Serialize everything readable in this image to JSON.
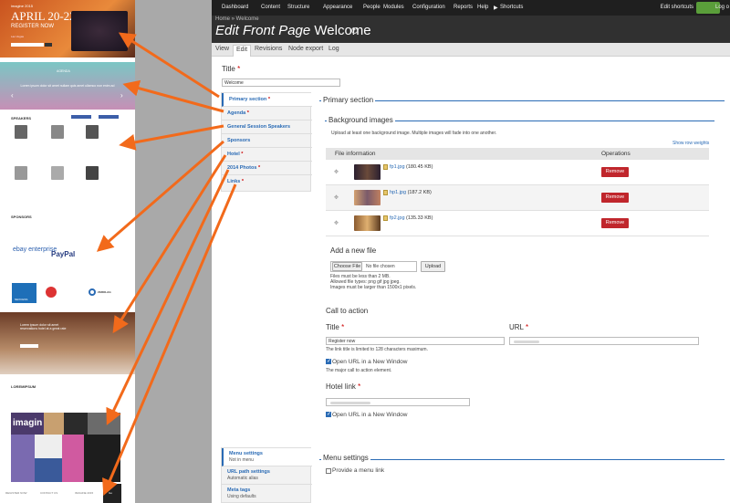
{
  "preview": {
    "hero": {
      "brand": "imagine 2015",
      "date": "APRIL 20-22",
      "register": "REGISTER NOW",
      "subtitle": "Las Vegas"
    },
    "agenda": {
      "title": "AGENDA",
      "text": "Lorem ipsum dolor sit amet nullam quis amet ullamco non enim ad"
    },
    "speakers_heading": "SPEAKERS",
    "sponsors_heading": "SPONSORS",
    "sponsor_logos": [
      "ebay enterprise",
      "PayPal",
      "NEXCESS",
      "ZEROLAG"
    ],
    "hotel_text": "Lorem ipsum dolor sit amet reservations hotel at a great rate",
    "lorem_heading": "LOREMIPSUM",
    "photo_word": "imagin",
    "footer": [
      "REGISTER NOW",
      "CONTACT US",
      "IMAGINE 2015",
      "Go"
    ]
  },
  "toolbar": {
    "items": [
      "Dashboard",
      "Content",
      "Structure",
      "Appearance",
      "People",
      "Modules",
      "Configuration",
      "Reports",
      "Help"
    ],
    "shortcuts": "Shortcuts",
    "edit_shortcuts": "Edit shortcuts",
    "logout": "Log o"
  },
  "header": {
    "breadcrumb": "Home » Welcome",
    "title_prefix": "Edit Front Page",
    "title_name": "Welcome"
  },
  "tabs": [
    "View",
    "Edit",
    "Revisions",
    "Node export",
    "Log"
  ],
  "title_field": {
    "label": "Title",
    "value": "Welcome"
  },
  "vertical_tabs": [
    {
      "label": "Primary section",
      "required": true
    },
    {
      "label": "Agenda",
      "required": true
    },
    {
      "label": "General Session Speakers",
      "required": false
    },
    {
      "label": "Sponsors",
      "required": false
    },
    {
      "label": "Hotel",
      "required": true
    },
    {
      "label": "2014 Photos",
      "required": true
    },
    {
      "label": "Links",
      "required": true
    }
  ],
  "primary_section": {
    "legend": "Primary section",
    "bg_legend": "Background images",
    "bg_help": "Upload at least one background image. Multiple images will fade into one another.",
    "show_weights": "Show row weights",
    "col_info": "File information",
    "col_ops": "Operations",
    "files": [
      {
        "name": "fp1.jpg",
        "size": "(180.45 KB)",
        "remove": "Remove"
      },
      {
        "name": "hp1.jpg",
        "size": "(187.2 KB)",
        "remove": "Remove"
      },
      {
        "name": "fp2.jpg",
        "size": "(135.33 KB)",
        "remove": "Remove"
      }
    ],
    "add_file": "Add a new file",
    "choose_file": "Choose File",
    "no_file": "No file chosen",
    "upload": "Upload",
    "rule1": "Files must be less than 2 MB.",
    "rule2": "Allowed file types: png gif jpg jpeg.",
    "rule3": "Images must be larger than 1500x1 pixels."
  },
  "cta": {
    "legend": "Call to action",
    "title_label": "Title",
    "url_label": "URL",
    "title_value": "Register now",
    "title_help": "The link title is limited to 128 characters maximum.",
    "new_window": "Open URL in a New Window",
    "cta_help": "The major call to action element."
  },
  "hotel_link": {
    "label": "Hotel link",
    "new_window": "Open URL in a New Window"
  },
  "bottom_tabs": [
    {
      "label": "Menu settings",
      "summary": "Not in menu"
    },
    {
      "label": "URL path settings",
      "summary": "Automatic alias"
    },
    {
      "label": "Meta tags",
      "summary": "Using defaults"
    }
  ],
  "menu_settings": {
    "legend": "Menu settings",
    "checkbox": "Provide a menu link"
  },
  "colors": {
    "accent": "#2a6bb5",
    "remove": "#c0262c",
    "arrow": "#f26a1b",
    "toolbar": "#1f1f1f",
    "header": "#303030"
  }
}
